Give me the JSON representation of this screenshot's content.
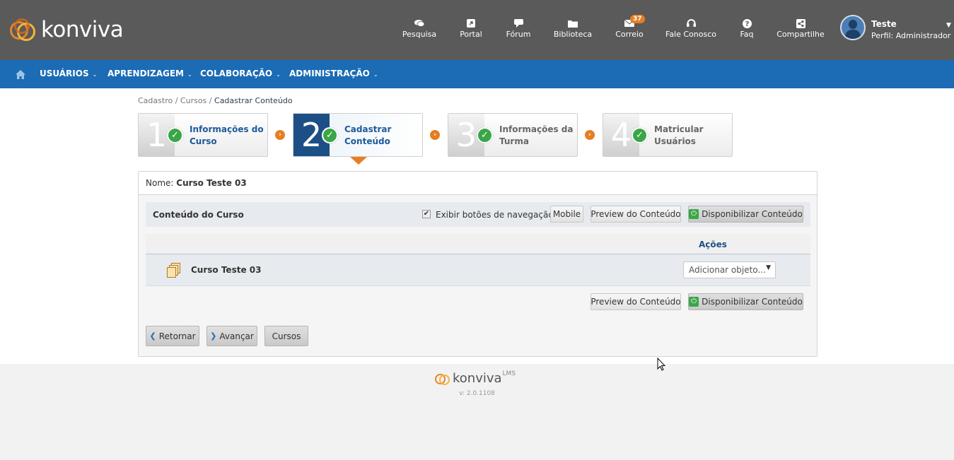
{
  "brand": {
    "name": "konviva"
  },
  "topnav": [
    {
      "label": "Pesquisa",
      "icon": "chat-bubbles-icon"
    },
    {
      "label": "Portal",
      "icon": "external-link-icon"
    },
    {
      "label": "Fórum",
      "icon": "comment-icon"
    },
    {
      "label": "Biblioteca",
      "icon": "folder-icon"
    },
    {
      "label": "Correio",
      "icon": "mail-icon",
      "badge": "37"
    },
    {
      "label": "Fale Conosco",
      "icon": "headset-icon"
    },
    {
      "label": "Faq",
      "icon": "question-icon"
    },
    {
      "label": "Compartilhe",
      "icon": "share-icon"
    }
  ],
  "user": {
    "name": "Teste",
    "profile": "Perfil: Administrador"
  },
  "mainnav": [
    {
      "label": "USUÁRIOS"
    },
    {
      "label": "APRENDIZAGEM"
    },
    {
      "label": "COLABORAÇÃO"
    },
    {
      "label": "ADMINISTRAÇÃO"
    }
  ],
  "breadcrumb": {
    "part1": "Cadastro",
    "sep": "/",
    "part2": "Cursos",
    "current": "Cadastrar Conteúdo"
  },
  "steps": [
    {
      "num": "1",
      "line1": "Informações do",
      "line2": "Curso"
    },
    {
      "num": "2",
      "line1": "Cadastrar",
      "line2": "Conteúdo"
    },
    {
      "num": "3",
      "line1": "Informações da",
      "line2": "Turma"
    },
    {
      "num": "4",
      "line1": "Matricular",
      "line2": "Usuários"
    }
  ],
  "course": {
    "name_label": "Nome:",
    "name_value": "Curso Teste 03"
  },
  "section": {
    "title": "Conteúdo do Curso",
    "checkbox_label": "Exibir botões de navegação",
    "mobile": "Mobile",
    "preview": "Preview do Conteúdo",
    "publish": "Disponibilizar Conteúdo"
  },
  "table": {
    "actions_header": "Ações",
    "rows": [
      {
        "name": "Curso Teste 03",
        "action_placeholder": "Adicionar objeto..."
      }
    ]
  },
  "nav_buttons": {
    "back": "Retornar",
    "next": "Avançar",
    "courses": "Cursos"
  },
  "footer": {
    "logo": "konviva",
    "sup": "LMS",
    "version": "v: 2.0.1108"
  },
  "colors": {
    "header": "#5a5a5a",
    "nav": "#1b6bb5",
    "accent": "#e67e22",
    "step_active": "#1c4f86",
    "check": "#3aa648"
  }
}
